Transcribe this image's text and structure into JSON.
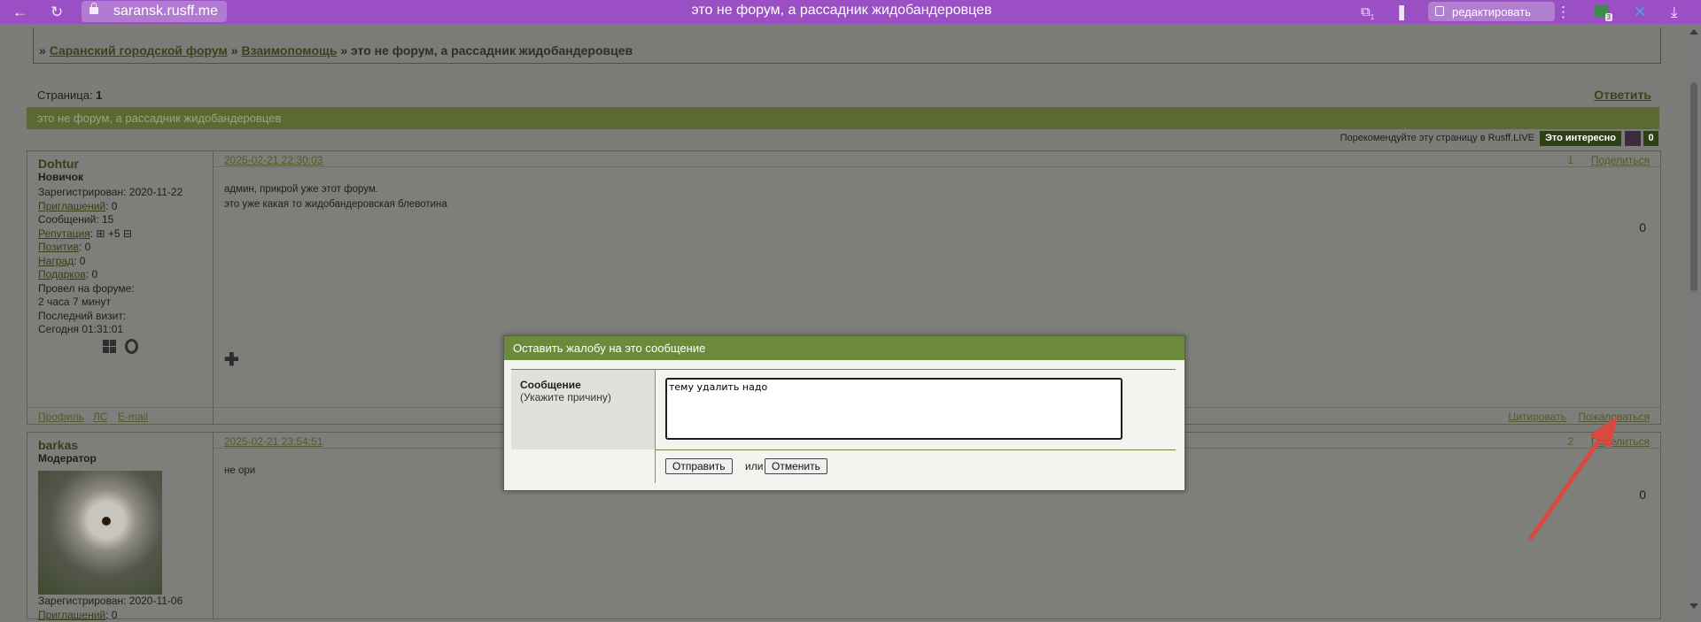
{
  "browser": {
    "host": "saransk.rusff.me",
    "tab_title": "это не форум, а рассадник жидобандеровцев",
    "edit_label": "редактировать",
    "ext_badge_count": "3",
    "tab_count_badge": "1",
    "icons": [
      "back-arrow-icon",
      "reload-icon",
      "lock-icon",
      "tab-counter-icon",
      "bookmark-icon",
      "edit-icon",
      "menu-dots-icon",
      "extension-icon",
      "sync-icon",
      "download-icon"
    ]
  },
  "breadcrumb": {
    "prefix": "»",
    "item1": "Саранский городской форум",
    "sep": "»",
    "item2": "Взаимопомощь",
    "current": "» это не форум, а рассадник жидобандеровцев"
  },
  "pagination": {
    "label": "Страница:",
    "page": "1"
  },
  "reply_label": "Ответить",
  "topic_title": "это не форум, а рассадник жидобандеровцев",
  "recommend": {
    "text": "Порекомендуйте эту страницу в Rusff.LIVE",
    "interest_label": "Это интересно",
    "count": "0"
  },
  "posts": [
    {
      "username": "Dohtur",
      "rank": "Новичок",
      "registered": "Зарегистрирован: 2020-11-22",
      "invites_label": "Приглашений",
      "invites": ": 0",
      "messages": "Сообщений: 15",
      "reputation_label": "Репутация",
      "reputation": "+5",
      "positive_label": "Позитив",
      "positive": ": 0",
      "awards_label": "Наград",
      "awards": ": 0",
      "gifts_label": "Подарков",
      "gifts": ": 0",
      "time_on_forum": "Провел на форуме:",
      "time_value": "2 часа 7 минут",
      "last_visit": "Последний визит:",
      "last_visit_value": "Сегодня 01:31:01",
      "date": "2025-02-21 22:30:03",
      "number": "1",
      "share": "Поделиться",
      "body_line1": "админ, прикрой уже этот форум.",
      "body_line2": "это уже какая то жидобандеровская блевотина",
      "score": "0",
      "footer_profile": "Профиль",
      "footer_pm": "ЛС",
      "footer_email": "E-mail",
      "footer_quote": "Цитировать",
      "footer_report": "Пожаловаться"
    },
    {
      "username": "barkas",
      "rank": "Модератор",
      "registered": "Зарегистрирован: 2020-11-06",
      "invites_label": "Приглашений",
      "invites": ": 0",
      "date": "2025-02-21 23:54:51",
      "number": "2",
      "share": "Поделиться",
      "body_line1": "не ори",
      "score": "0"
    }
  ],
  "modal": {
    "title": "Оставить жалобу на это сообщение",
    "field_label": "Сообщение",
    "field_hint": "(Укажите причину)",
    "field_value": "тему удалить надо",
    "submit_label": "Отправить",
    "or_label": "или",
    "cancel_label": "Отменить"
  }
}
